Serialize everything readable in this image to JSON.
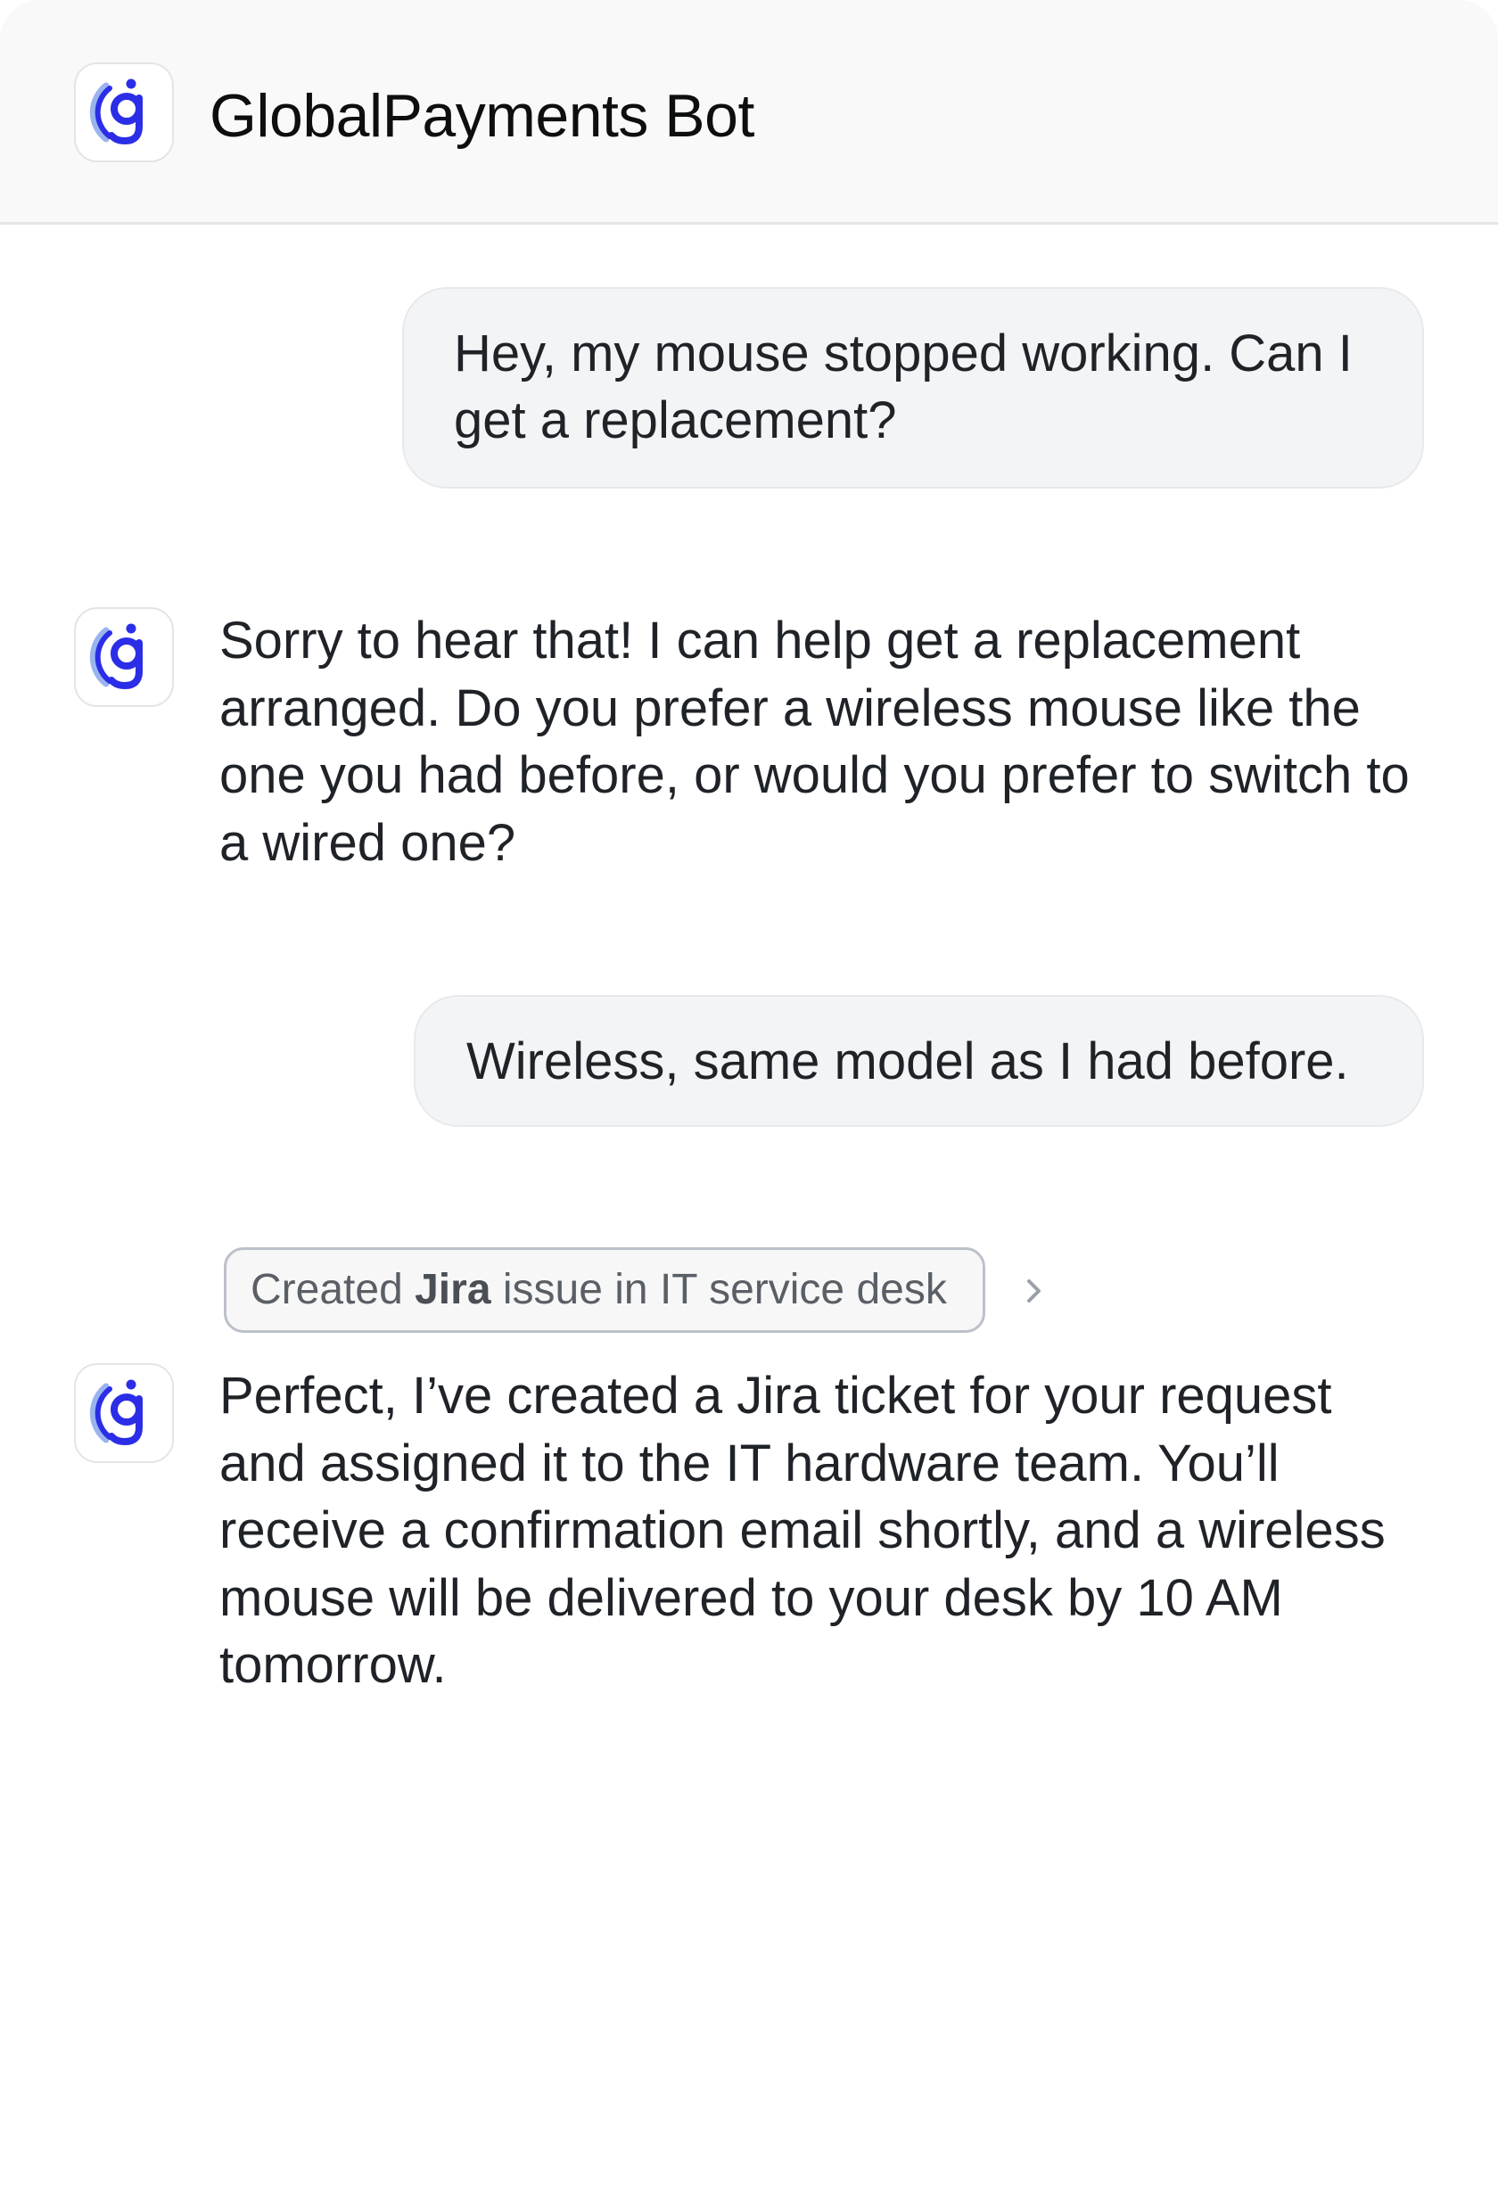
{
  "header": {
    "title": "GlobalPayments Bot",
    "logo_icon": "globalpayments-g-logo-icon"
  },
  "colors": {
    "brand_blue": "#2b2ee6",
    "brand_light_blue": "#9ab4ef",
    "bubble_bg": "#f3f4f6",
    "header_bg": "#f9f9f9"
  },
  "messages": [
    {
      "role": "user",
      "text": "Hey, my mouse stopped working. Can I get a replacement?"
    },
    {
      "role": "bot",
      "text": "Sorry to hear that! I can help get a replacement arranged. Do you prefer a wireless mouse like the one you had before, or would you prefer to switch to a wired one?"
    },
    {
      "role": "user",
      "text": "Wireless, same model as I had before."
    },
    {
      "role": "bot",
      "tool_action": {
        "prefix": "Created ",
        "app": "Jira",
        "suffix": " issue in IT service desk",
        "icon": "chevron-right-icon"
      },
      "text": "Perfect, I’ve created a Jira ticket for your request and assigned it to the IT hardware team. You’ll receive a confirmation email shortly, and a wireless mouse will be delivered to your desk by 10 AM tomorrow."
    }
  ]
}
